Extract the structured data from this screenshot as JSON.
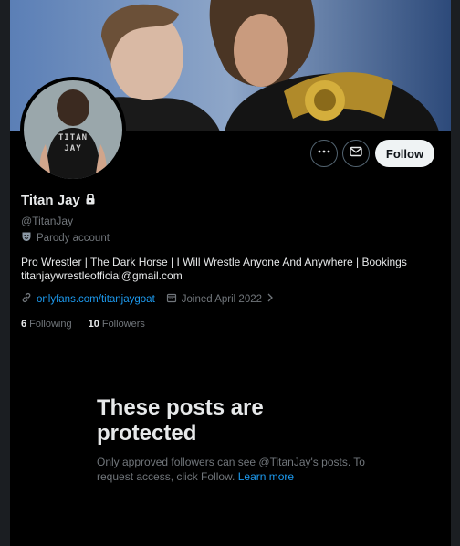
{
  "profile": {
    "name": "Titan Jay",
    "handle": "@TitanJay",
    "parody_label": "Parody account",
    "bio_line1": "Pro Wrestler | The Dark Horse | I Will Wrestle Anyone And Anywhere | Bookings",
    "bio_line2": "titanjaywrestleofficial@gmail.com",
    "website": "onlyfans.com/titanjaygoat",
    "joined": "Joined April 2022",
    "following_count": "6",
    "following_label": "Following",
    "followers_count": "10",
    "followers_label": "Followers",
    "avatar_shirt_line1": "TITAN",
    "avatar_shirt_line2": "JAY"
  },
  "actions": {
    "follow_label": "Follow"
  },
  "protected": {
    "title_line1": "These posts are",
    "title_line2": "protected",
    "desc_text": "Only approved followers can see @TitanJay's posts. To request access, click Follow.",
    "learn_more": "Learn more"
  },
  "icons": {
    "more": "more-horizontal-icon",
    "message": "envelope-icon",
    "lock": "lock-icon",
    "parody": "parody-mask-icon",
    "link": "link-icon",
    "calendar": "calendar-icon",
    "chevron": "chevron-right-icon"
  },
  "colors": {
    "background": "#000000",
    "accent": "#1d9bf0",
    "muted": "#71767b",
    "text": "#e7e9ea"
  }
}
